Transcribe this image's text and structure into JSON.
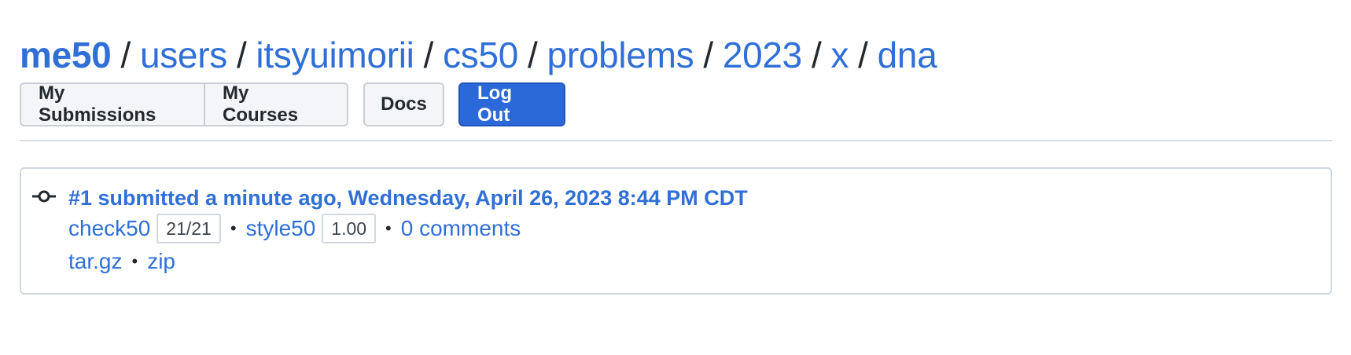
{
  "breadcrumb": {
    "root": "me50",
    "separator": "/",
    "items": [
      "users",
      "itsyuimorii",
      "cs50",
      "problems",
      "2023",
      "x",
      "dna"
    ]
  },
  "nav": {
    "my_submissions": "My Submissions",
    "my_courses": "My Courses",
    "docs": "Docs",
    "log_out": "Log Out"
  },
  "colors": {
    "link": "#2f6fd6",
    "primary_button": "#2b68d8"
  },
  "submission": {
    "icon": "commit-icon",
    "title": "#1 submitted a minute ago, Wednesday, April 26, 2023 8:44 PM CDT",
    "check50_label": "check50",
    "check50_score": "21/21",
    "style50_label": "style50",
    "style50_score": "1.00",
    "comments": "0 comments",
    "separator": "•",
    "downloads": [
      "tar.gz",
      "zip"
    ]
  }
}
